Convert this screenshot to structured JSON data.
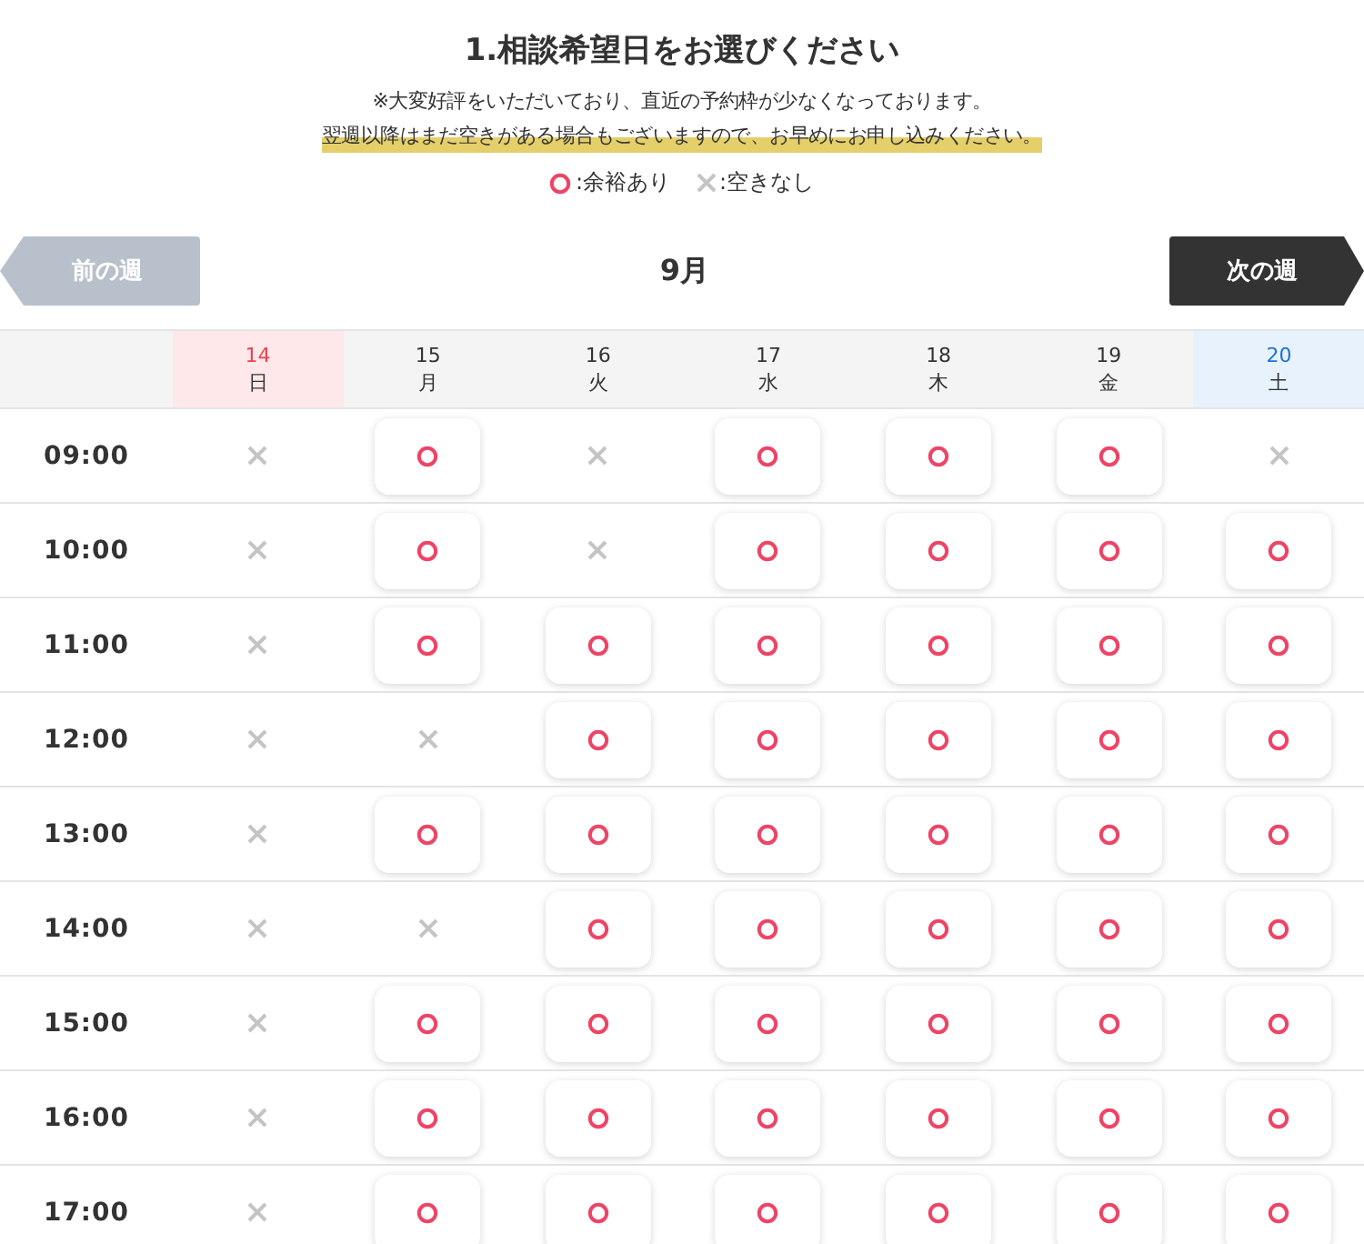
{
  "heading": "1.相談希望日をお選びください",
  "notes": [
    {
      "text": "※大変好評をいただいており、直近の予約枠が少なくなっております。",
      "highlighted": false
    },
    {
      "text": "翌週以降はまだ空きがある場合もございますので、お早めにお申し込みください。",
      "highlighted": true
    }
  ],
  "legend": [
    {
      "available": true,
      "label": ":余裕あり"
    },
    {
      "available": false,
      "label": ":空きなし"
    }
  ],
  "nav": {
    "prev": {
      "label": "前の週",
      "disabled": true
    },
    "month": "9月",
    "next": {
      "label": "次の週",
      "disabled": false
    }
  },
  "days": [
    {
      "date": "14",
      "weekday": "日",
      "kind": "sunday"
    },
    {
      "date": "15",
      "weekday": "月",
      "kind": "weekday"
    },
    {
      "date": "16",
      "weekday": "火",
      "kind": "weekday"
    },
    {
      "date": "17",
      "weekday": "水",
      "kind": "weekday"
    },
    {
      "date": "18",
      "weekday": "木",
      "kind": "weekday"
    },
    {
      "date": "19",
      "weekday": "金",
      "kind": "weekday"
    },
    {
      "date": "20",
      "weekday": "土",
      "kind": "saturday"
    }
  ],
  "rows": [
    {
      "time": "09:00",
      "slots": [
        false,
        true,
        false,
        true,
        true,
        true,
        false
      ]
    },
    {
      "time": "10:00",
      "slots": [
        false,
        true,
        false,
        true,
        true,
        true,
        true
      ]
    },
    {
      "time": "11:00",
      "slots": [
        false,
        true,
        true,
        true,
        true,
        true,
        true
      ]
    },
    {
      "time": "12:00",
      "slots": [
        false,
        false,
        true,
        true,
        true,
        true,
        true
      ]
    },
    {
      "time": "13:00",
      "slots": [
        false,
        true,
        true,
        true,
        true,
        true,
        true
      ]
    },
    {
      "time": "14:00",
      "slots": [
        false,
        false,
        true,
        true,
        true,
        true,
        true
      ]
    },
    {
      "time": "15:00",
      "slots": [
        false,
        true,
        true,
        true,
        true,
        true,
        true
      ]
    },
    {
      "time": "16:00",
      "slots": [
        false,
        true,
        true,
        true,
        true,
        true,
        true
      ]
    },
    {
      "time": "17:00",
      "slots": [
        false,
        true,
        true,
        true,
        true,
        true,
        true
      ]
    }
  ]
}
